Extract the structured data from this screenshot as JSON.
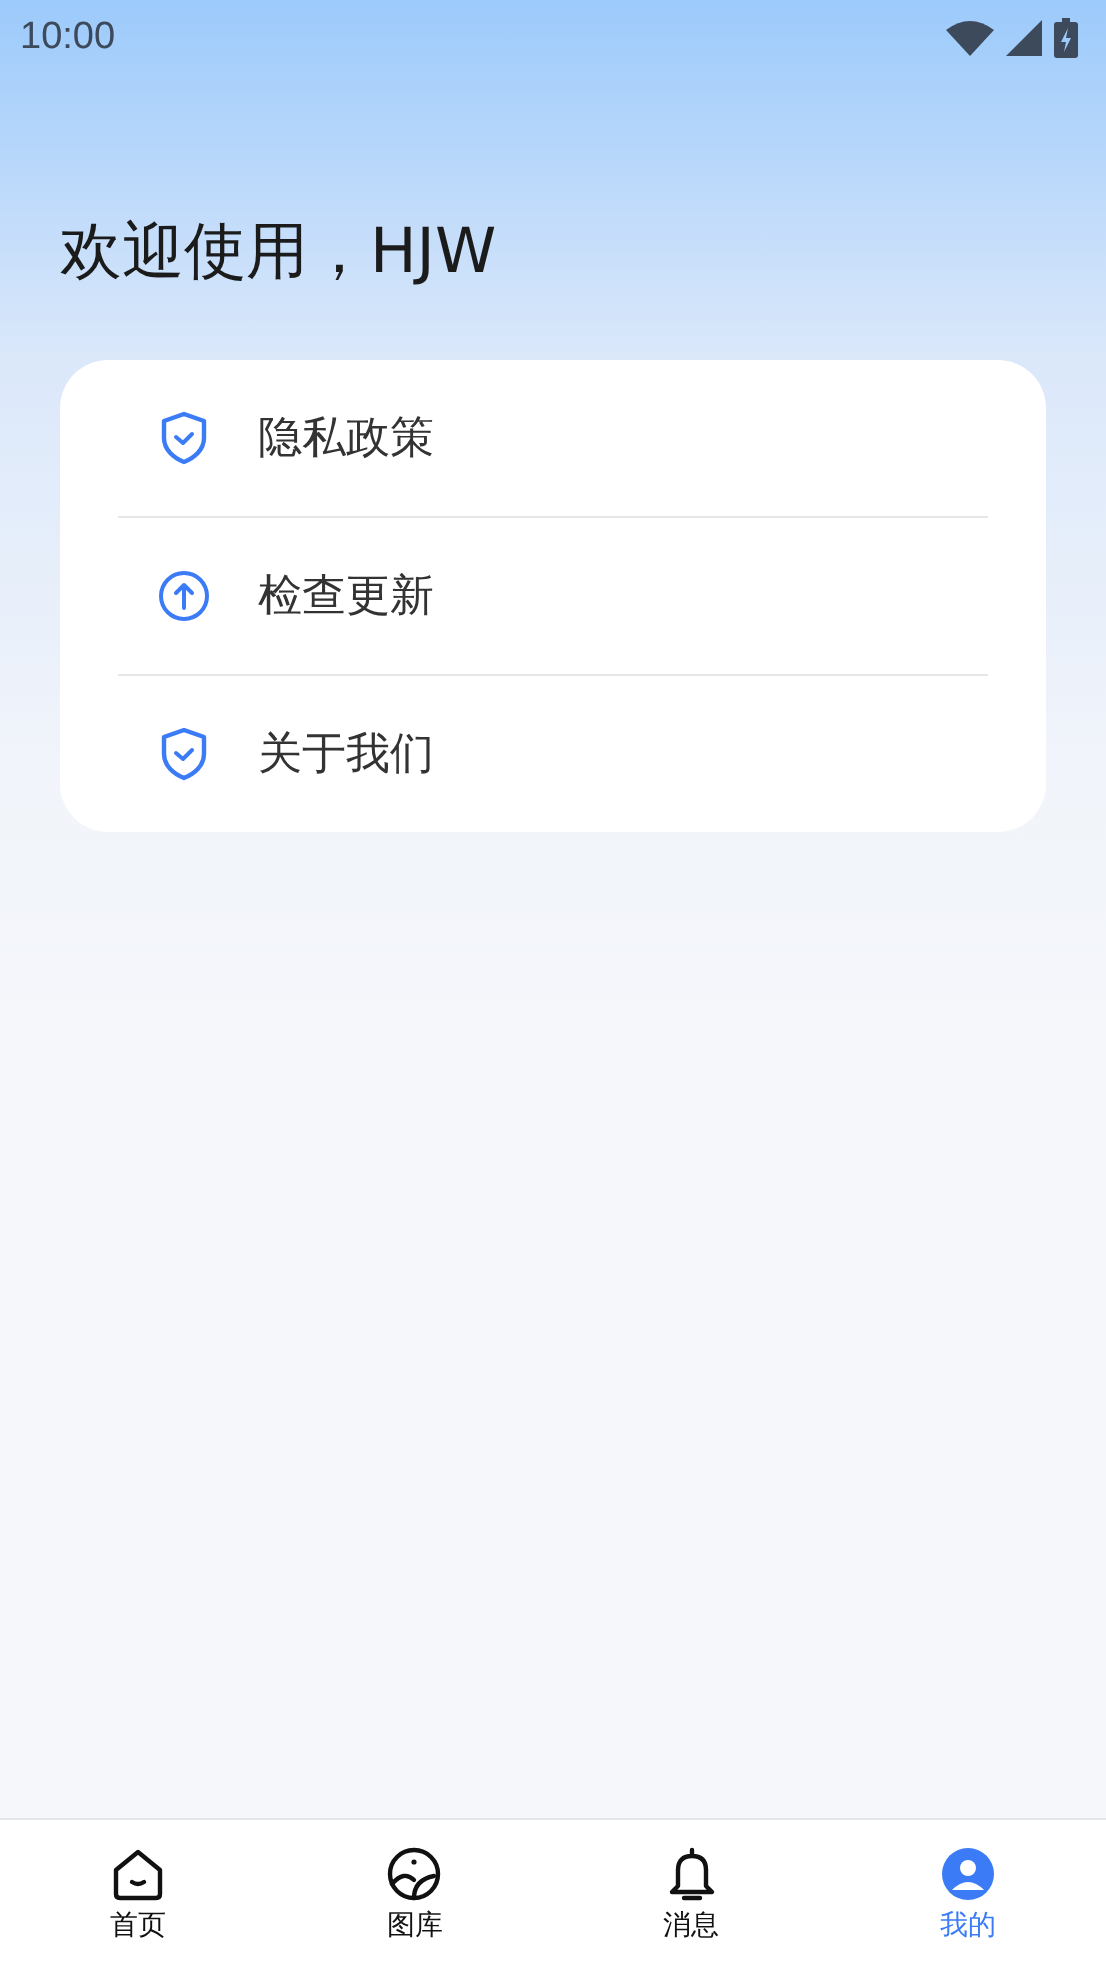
{
  "status_bar": {
    "time": "10:00"
  },
  "greeting": "欢迎使用，HJW",
  "menu": [
    {
      "kind": "shield",
      "label": "隐私政策"
    },
    {
      "kind": "upload",
      "label": "检查更新"
    },
    {
      "kind": "shield",
      "label": "关于我们"
    }
  ],
  "bottom_nav": [
    {
      "kind": "home",
      "label": "首页",
      "selected": false
    },
    {
      "kind": "gallery",
      "label": "图库",
      "selected": false
    },
    {
      "kind": "bell",
      "label": "消息",
      "selected": false
    },
    {
      "kind": "profile",
      "label": "我的",
      "selected": true
    }
  ]
}
